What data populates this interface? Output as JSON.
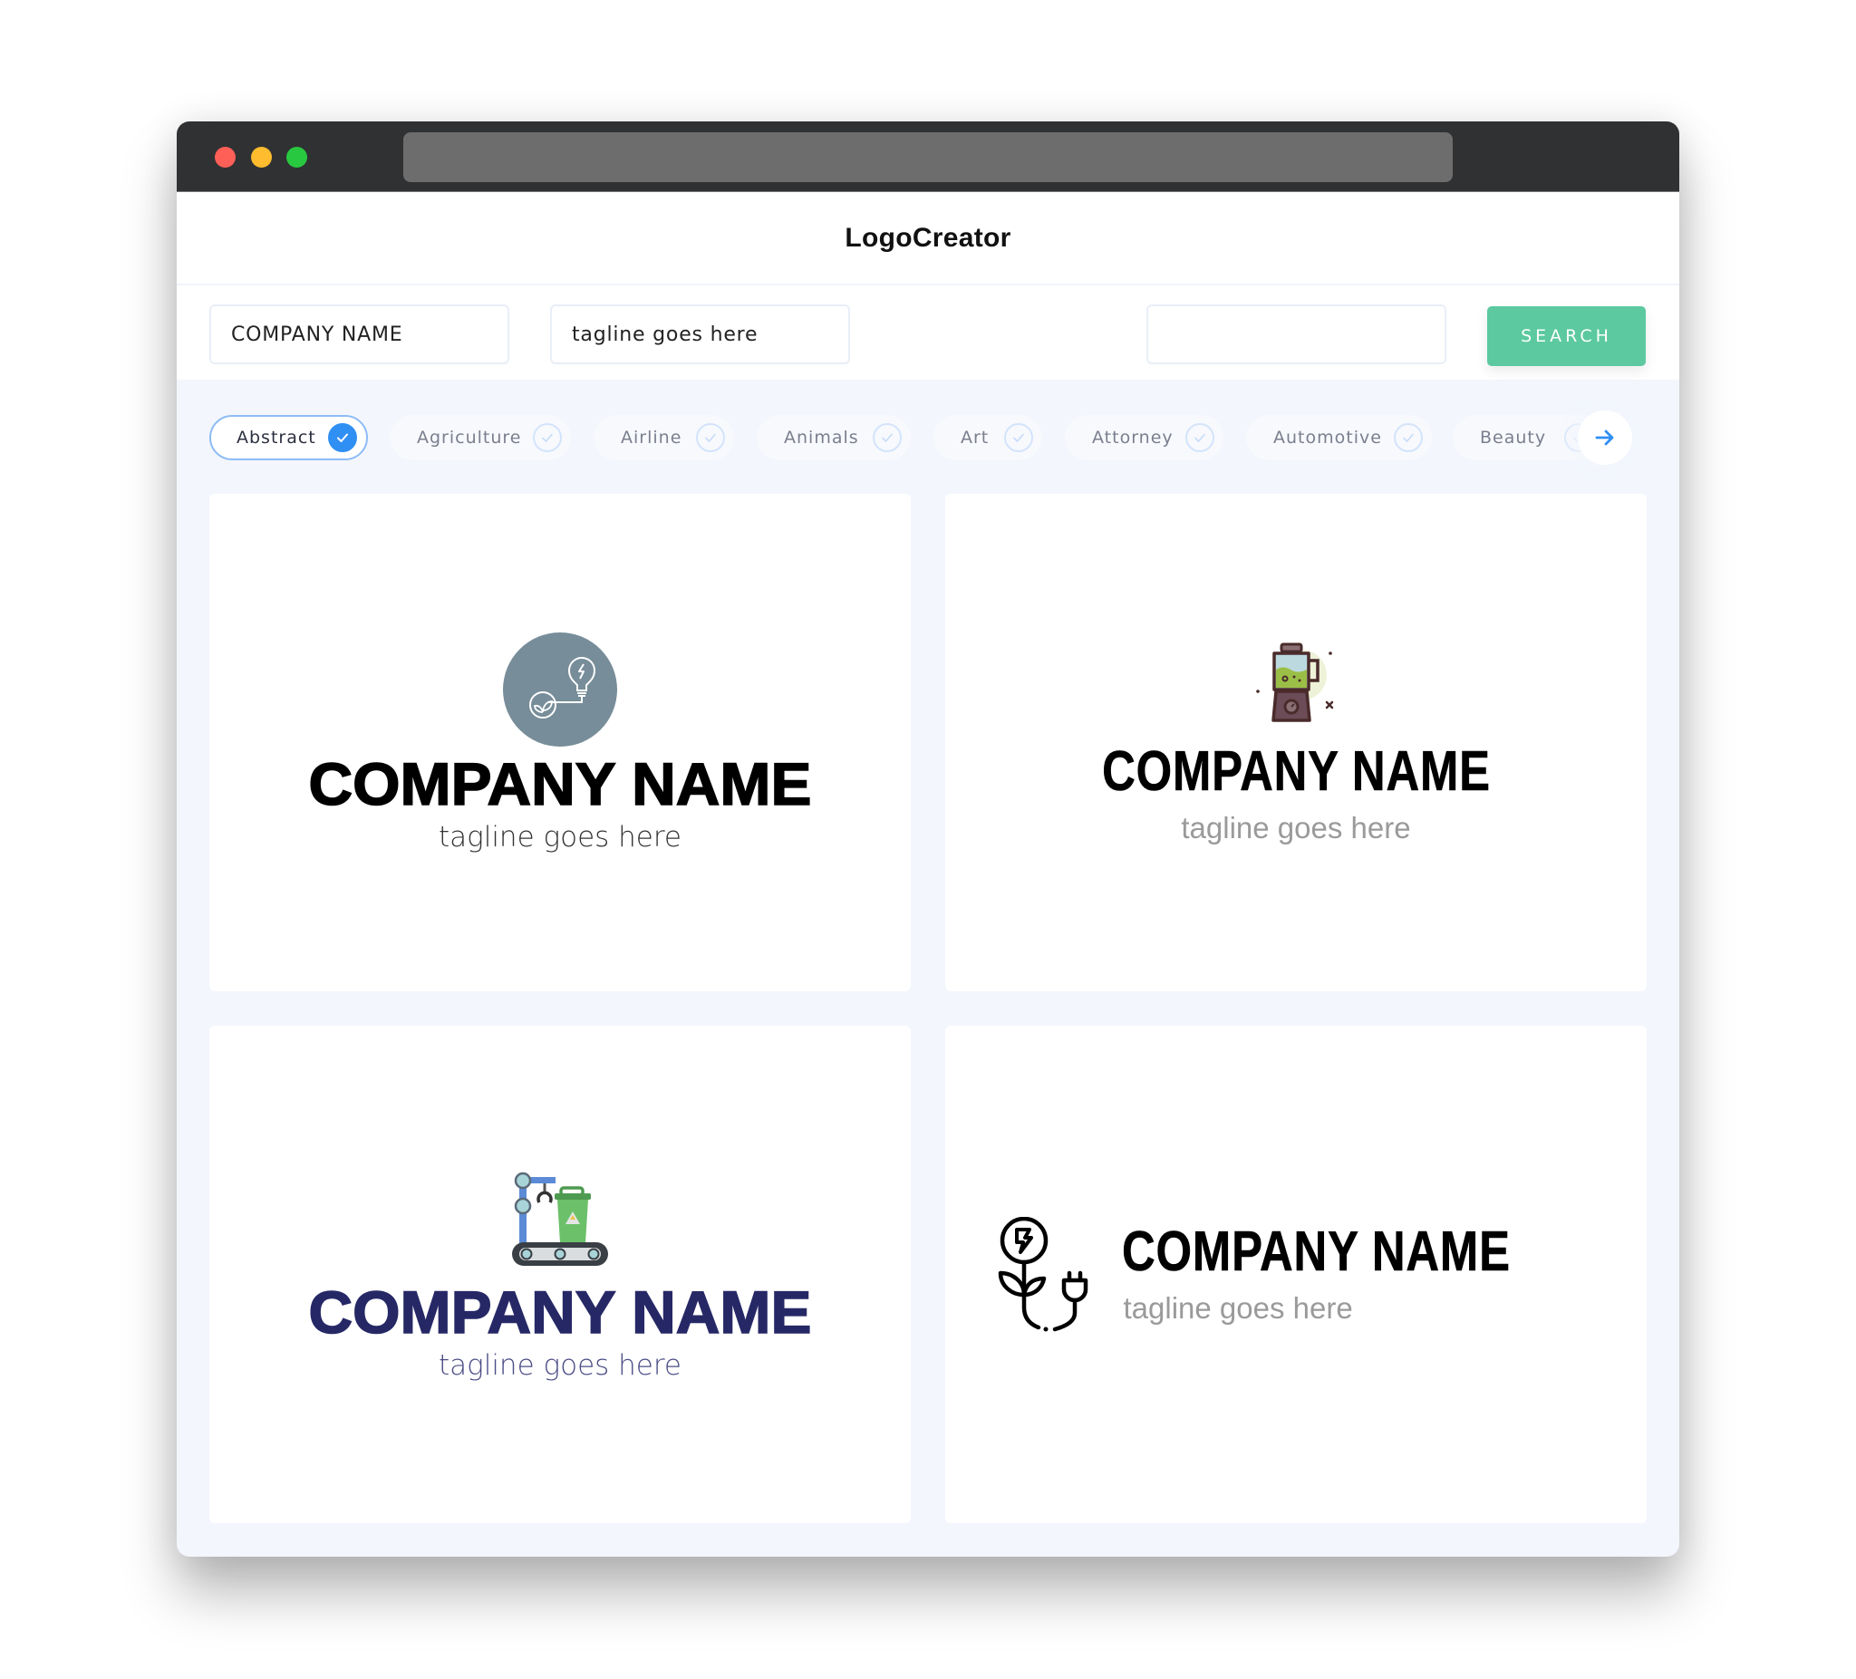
{
  "window": {
    "controls": [
      "close",
      "minimize",
      "maximize"
    ]
  },
  "app": {
    "title": "LogoCreator"
  },
  "search": {
    "company_value": "COMPANY NAME",
    "tagline_value": "tagline goes here",
    "query_value": "",
    "button_label": "SEARCH",
    "button_color": "#5cc9a0"
  },
  "categories": {
    "items": [
      {
        "label": "Abstract",
        "selected": true
      },
      {
        "label": "Agriculture",
        "selected": false
      },
      {
        "label": "Airline",
        "selected": false
      },
      {
        "label": "Animals",
        "selected": false
      },
      {
        "label": "Art",
        "selected": false
      },
      {
        "label": "Attorney",
        "selected": false
      },
      {
        "label": "Automotive",
        "selected": false
      },
      {
        "label": "Beauty",
        "selected": false
      }
    ],
    "next_icon": "arrow-right-icon",
    "accent_color": "#2f8ff3"
  },
  "logos": [
    {
      "icon": "lightbulb-plant-icon",
      "company": "COMPANY NAME",
      "tagline": "tagline goes here",
      "name_color": "#000000",
      "tagline_color": "#333333"
    },
    {
      "icon": "blender-icon",
      "company": "COMPANY NAME",
      "tagline": "tagline goes here",
      "name_color": "#000000",
      "tagline_color": "#9a9a9a"
    },
    {
      "icon": "recycling-conveyor-icon",
      "company": "COMPANY NAME",
      "tagline": "tagline goes here",
      "name_color": "#262866",
      "tagline_color": "#4a4c86"
    },
    {
      "icon": "plant-plug-icon",
      "company": "COMPANY NAME",
      "tagline": "tagline goes here",
      "name_color": "#000000",
      "tagline_color": "#9a9a9a"
    }
  ]
}
